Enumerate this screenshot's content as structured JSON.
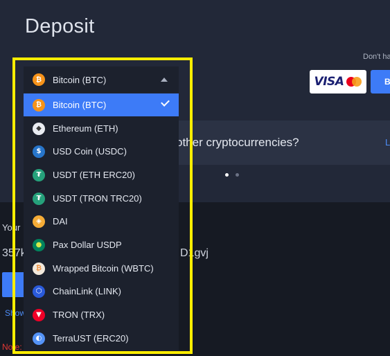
{
  "header": {
    "title": "Deposit"
  },
  "promo": {
    "dont_have_text": "Don't ha",
    "visa_label": "VISA",
    "buy_label": "B"
  },
  "banner": {
    "text": "other cryptocurrencies?",
    "link_label": "L",
    "carousel": {
      "pages": 2,
      "active_page": 1
    }
  },
  "deposit": {
    "your_label": "Your",
    "address_start": "357k",
    "address_end": "D1gvj",
    "show_label": "Show",
    "note_label": "Note:"
  },
  "currency_select": {
    "selected": {
      "label": "Bitcoin (BTC)",
      "icon": "bitcoin-icon",
      "symbol": "₿",
      "color": "#f7931a"
    },
    "options": [
      {
        "label": "Bitcoin (BTC)",
        "icon": "bitcoin-icon",
        "symbol": "₿",
        "color": "#f7931a",
        "selected": true
      },
      {
        "label": "Ethereum (ETH)",
        "icon": "ethereum-icon",
        "symbol": "◆",
        "color": "#e9ecf2",
        "selected": false
      },
      {
        "label": "USD Coin (USDC)",
        "icon": "usd-coin-icon",
        "symbol": "$",
        "color": "#2775ca",
        "selected": false
      },
      {
        "label": "USDT (ETH ERC20)",
        "icon": "tether-icon",
        "symbol": "₮",
        "color": "#26a17b",
        "selected": false
      },
      {
        "label": "USDT (TRON TRC20)",
        "icon": "tether-tron-icon",
        "symbol": "₮",
        "color": "#26a17b",
        "selected": false
      },
      {
        "label": "DAI",
        "icon": "dai-icon",
        "symbol": "◈",
        "color": "#f5ac37",
        "selected": false
      },
      {
        "label": "Pax Dollar USDP",
        "icon": "pax-dollar-icon",
        "symbol": "●",
        "color": "#00845d",
        "selected": false
      },
      {
        "label": "Wrapped Bitcoin (WBTC)",
        "icon": "wrapped-bitcoin-icon",
        "symbol": "₿",
        "color": "#f09242",
        "selected": false
      },
      {
        "label": "ChainLink (LINK)",
        "icon": "chainlink-icon",
        "symbol": "⬡",
        "color": "#2a5ada",
        "selected": false
      },
      {
        "label": "TRON (TRX)",
        "icon": "tron-icon",
        "symbol": "▼",
        "color": "#ef0027",
        "selected": false
      },
      {
        "label": "TerraUST (ERC20)",
        "icon": "terrausd-icon",
        "symbol": "◐",
        "color": "#5493f7",
        "selected": false
      }
    ]
  },
  "colors": {
    "accent": "#3d7bf7",
    "highlight": "#ffee00",
    "background": "#222838",
    "note": "#e53935"
  }
}
